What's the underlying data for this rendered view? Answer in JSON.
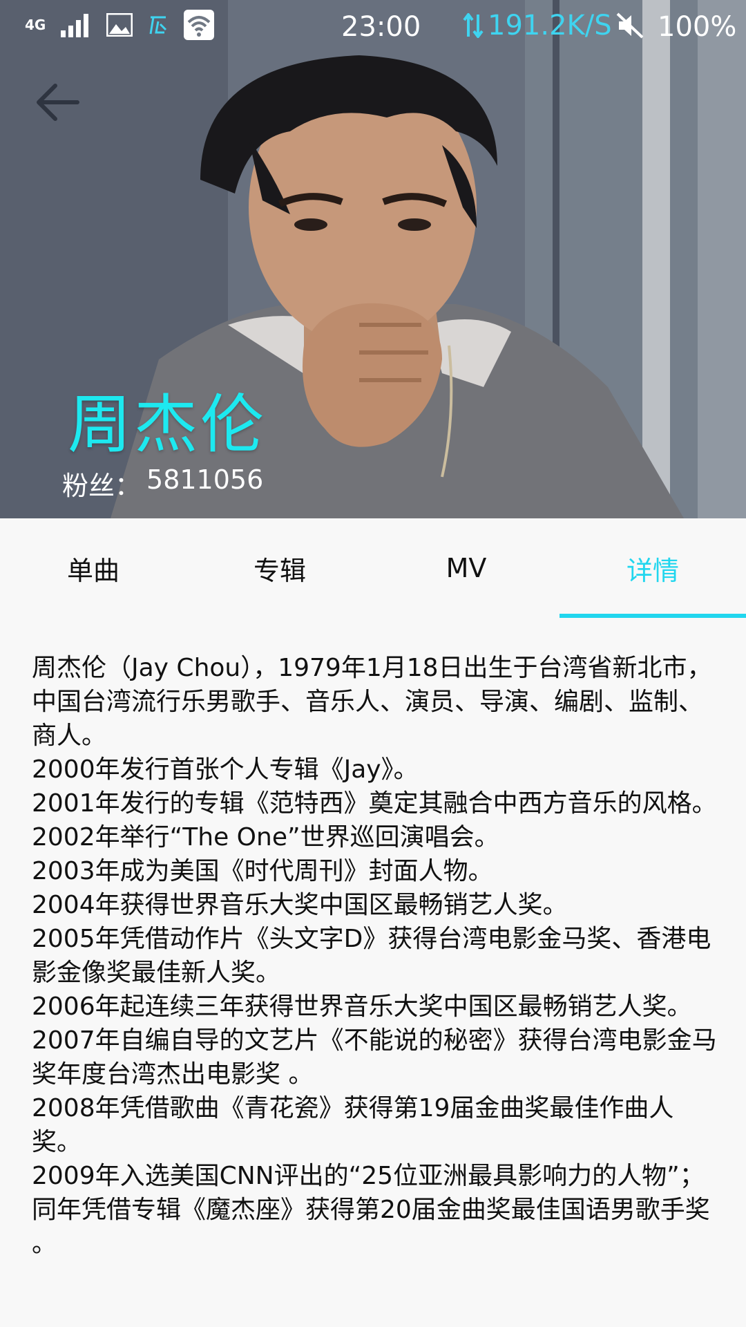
{
  "status_bar": {
    "network": "4G",
    "time": "23:00",
    "speed": "191.2K/S",
    "battery": "100%",
    "accent": "#3fd4f0"
  },
  "header": {
    "back_icon": "arrow-left-icon",
    "artist_name": "周杰伦",
    "fans_label": "粉丝：",
    "fans_count": "5811056",
    "name_color": "#1de9f0"
  },
  "tabs": [
    {
      "label": "单曲",
      "active": false
    },
    {
      "label": "专辑",
      "active": false
    },
    {
      "label": "MV",
      "active": false
    },
    {
      "label": "详情",
      "active": true
    }
  ],
  "accent_color": "#21d6ee",
  "details": [
    "周杰伦（Jay Chou），1979年1月18日出生于台湾省新北市，中国台湾流行乐男歌手、音乐人、演员、导演、编剧、监制、商人。",
    "2000年发行首张个人专辑《Jay》。",
    "2001年发行的专辑《范特西》奠定其融合中西方音乐的风格。",
    "2002年举行“The One”世界巡回演唱会。",
    "2003年成为美国《时代周刊》封面人物。",
    "2004年获得世界音乐大奖中国区最畅销艺人奖。",
    "2005年凭借动作片《头文字D》获得台湾电影金马奖、香港电影金像奖最佳新人奖。",
    "2006年起连续三年获得世界音乐大奖中国区最畅销艺人奖。",
    "2007年自编自导的文艺片《不能说的秘密》获得台湾电影金马奖年度台湾杰出电影奖 。",
    "2008年凭借歌曲《青花瓷》获得第19届金曲奖最佳作曲人奖。",
    "2009年入选美国CNN评出的“25位亚洲最具影响力的人物”；同年凭借专辑《魔杰座》获得第20届金曲奖最佳国语男歌手奖 。"
  ]
}
